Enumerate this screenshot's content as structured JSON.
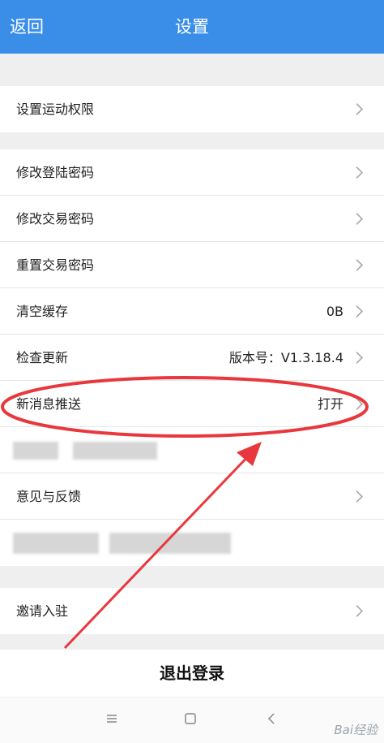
{
  "header": {
    "back_label": "返回",
    "title": "设置"
  },
  "sections": {
    "permissions": {
      "item": "设置运动权限"
    },
    "account": {
      "items": [
        {
          "label": "修改登陆密码",
          "value": ""
        },
        {
          "label": "修改交易密码",
          "value": ""
        },
        {
          "label": "重置交易密码",
          "value": ""
        },
        {
          "label": "清空缓存",
          "value": "0B"
        },
        {
          "label": "检查更新",
          "value": "版本号：V1.3.18.4"
        },
        {
          "label": "新消息推送",
          "value": "打开"
        },
        {
          "label": "",
          "value": ""
        },
        {
          "label": "意见与反馈",
          "value": ""
        },
        {
          "label": "",
          "value": ""
        }
      ]
    },
    "invite": {
      "item": "邀请入驻"
    }
  },
  "logout_label": "退出登录",
  "watermark": "Bai经验",
  "colors": {
    "header_bg": "#3a8ee8",
    "annotation": "#e8383d"
  },
  "icons": {
    "chevron": "chevron-right-icon",
    "menu": "menu-icon",
    "home": "home-square-icon",
    "back": "back-triangle-icon"
  }
}
